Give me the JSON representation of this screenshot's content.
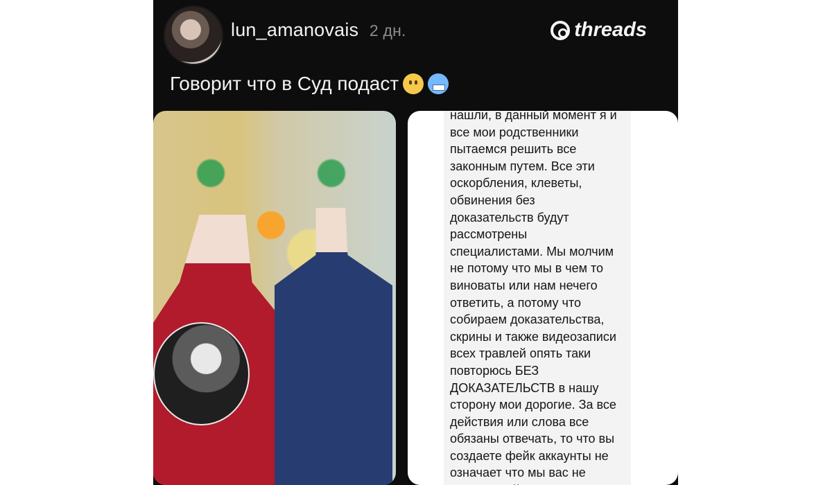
{
  "post": {
    "username": "lun_amanovais",
    "timestamp": "2 дн.",
    "brand": "threads",
    "caption": "Говорит что в Суд подаст",
    "caption_emojis": [
      "worried-face-emoji",
      "cold-face-emoji"
    ],
    "note_lines": [
      "нашли, в данный момент я и",
      "все мои родственники",
      "пытаемся решить все",
      "законным путем. Все эти",
      "оскорбления, клеветы,",
      "обвинения без",
      "доказательств будут",
      "рассмотрены",
      "специалистами. Мы молчим",
      "не потому что мы в чем то",
      "виноваты или нам нечего",
      "ответить, а потому что",
      "собираем доказательства,",
      "скрины и также видеозаписи",
      "всех травлей опять таки",
      "повторюсь БЕЗ",
      "ДОКАЗАТЕЛЬСТВ в нашу",
      "сторону мои дорогие. За все",
      "действия или слова все",
      "обязаны отвечать, то что вы",
      "создаете фейк аккаунты не",
      "означает что мы вас не",
      "сможем найти, мы только"
    ]
  }
}
